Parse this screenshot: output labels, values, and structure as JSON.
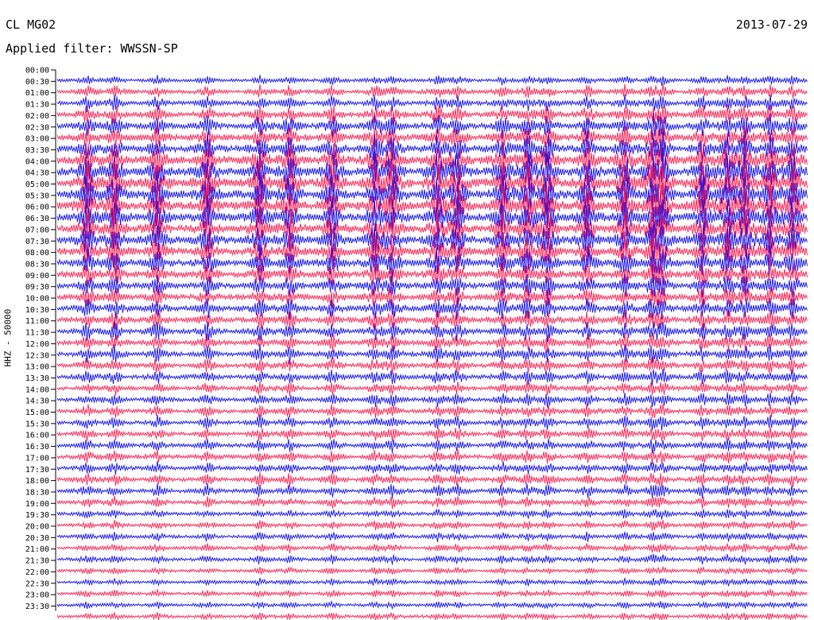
{
  "header": {
    "station": "CL MG02",
    "date": "2013-07-29",
    "filter": "Applied filter: WWSSN-SP"
  },
  "colors": {
    "trace_a": "#1010ee",
    "trace_b": "#ff1a4d",
    "background": "#ffffff"
  },
  "chart_data": {
    "type": "line",
    "title": "",
    "ylabel": "HHZ - 50000",
    "xlabel": "",
    "grid": false,
    "legend": "none",
    "row_labels": [
      "00:00",
      "00:30",
      "01:00",
      "01:30",
      "02:00",
      "02:30",
      "03:00",
      "03:30",
      "04:00",
      "04:30",
      "05:00",
      "05:30",
      "06:00",
      "06:30",
      "07:00",
      "07:30",
      "08:00",
      "08:30",
      "09:00",
      "09:30",
      "10:00",
      "10:30",
      "11:00",
      "11:30",
      "12:00",
      "12:30",
      "13:00",
      "13:30",
      "14:00",
      "14:30",
      "15:00",
      "15:30",
      "16:00",
      "16:30",
      "17:00",
      "17:30",
      "18:00",
      "18:30",
      "19:00",
      "19:30",
      "20:00",
      "20:30",
      "21:00",
      "21:30",
      "22:00",
      "22:30",
      "23:00",
      "23:30"
    ],
    "row_colors": "alternating trace_a / trace_b, starting with trace_a at 00:00",
    "x_range_minutes": [
      0,
      30
    ],
    "activity_levels": [
      0.2,
      0.3,
      0.35,
      0.45,
      0.55,
      0.6,
      0.7,
      0.85,
      0.95,
      1.0,
      1.0,
      0.95,
      0.9,
      0.85,
      0.85,
      0.8,
      0.7,
      0.6,
      0.55,
      0.5,
      0.5,
      0.45,
      0.45,
      0.4,
      0.4,
      0.35,
      0.35,
      0.3,
      0.3,
      0.3,
      0.3,
      0.3,
      0.3,
      0.3,
      0.3,
      0.3,
      0.3,
      0.25,
      0.2,
      0.2,
      0.2,
      0.2,
      0.2,
      0.15,
      0.15,
      0.15,
      0.15,
      0.15
    ],
    "event_minutes": [
      1.2,
      2.3,
      4.0,
      6.0,
      8.1,
      9.3,
      11.0,
      12.7,
      13.4,
      15.2,
      16.0,
      17.8,
      18.8,
      19.6,
      21.2,
      22.7,
      23.8,
      24.2,
      25.8,
      26.8,
      27.5,
      28.5,
      29.4
    ]
  }
}
